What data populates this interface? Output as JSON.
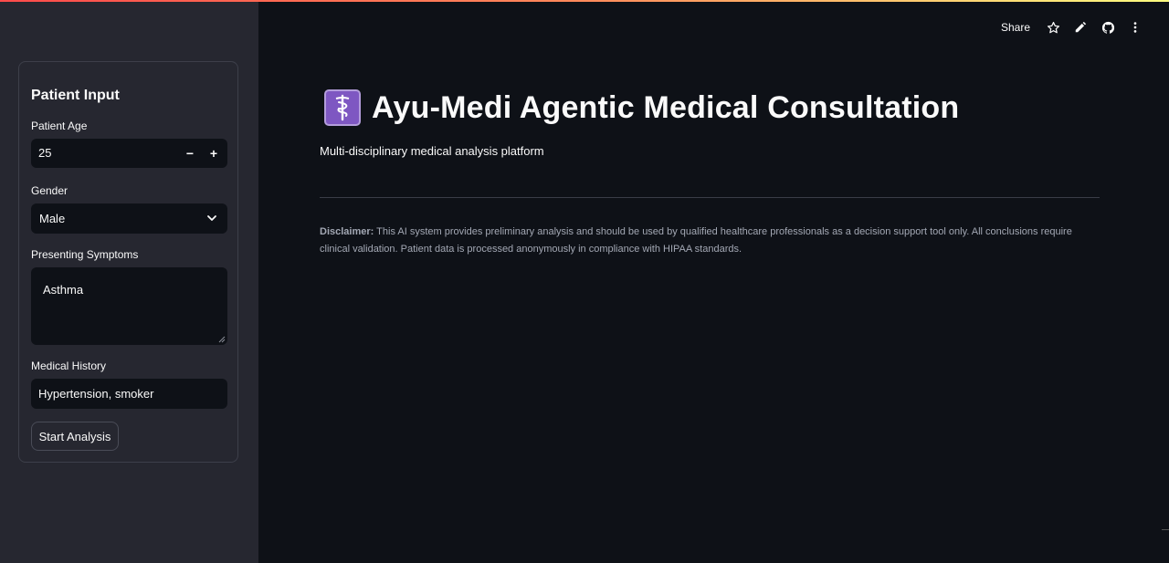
{
  "sidebar": {
    "form_title": "Patient Input",
    "age": {
      "label": "Patient Age",
      "value": "25",
      "minus": "−",
      "plus": "+"
    },
    "gender": {
      "label": "Gender",
      "value": "Male"
    },
    "symptoms": {
      "label": "Presenting Symptoms",
      "value": "Asthma"
    },
    "history": {
      "label": "Medical History",
      "value": "Hypertension, smoker"
    },
    "start_button": "Start Analysis"
  },
  "toolbar": {
    "share": "Share",
    "icons": [
      "star-icon",
      "pencil-icon",
      "github-icon",
      "more-vertical-icon"
    ]
  },
  "main": {
    "title_icon": "⚕",
    "title": "Ayu-Medi Agentic Medical Consultation",
    "subtitle": "Multi-disciplinary medical analysis platform",
    "disclaimer_label": "Disclaimer:",
    "disclaimer_text": " This AI system provides preliminary analysis and should be used by qualified healthcare professionals as a decision support tool only. All conclusions require clinical validation. Patient data is processed anonymously in compliance with HIPAA standards."
  },
  "colors": {
    "background": "#0e1117",
    "sidebar": "#262730",
    "accent_gradient_start": "#ff4b4b",
    "accent_gradient_end": "#fffd80",
    "title_icon_bg": "#7e57c2"
  }
}
